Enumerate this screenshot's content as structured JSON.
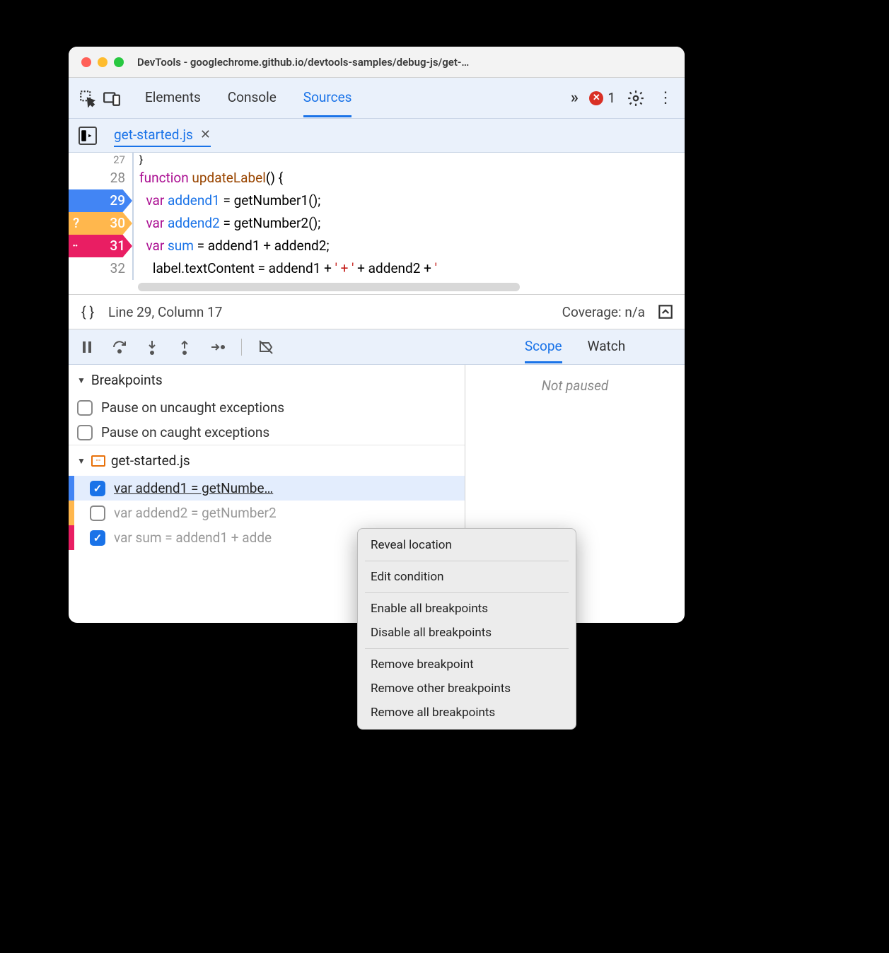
{
  "window": {
    "title": "DevTools - googlechrome.github.io/devtools-samples/debug-js/get-…"
  },
  "topTabs": {
    "elements": "Elements",
    "console": "Console",
    "sources": "Sources",
    "error_count": "1"
  },
  "fileTab": {
    "name": "get-started.js"
  },
  "code": {
    "l27": "  }",
    "l28_func": "function",
    "l28_name": " updateLabel",
    "l28_rest": "() {",
    "l29_var": "var",
    "l29_name": " addend1",
    "l29_rest": " = getNumber1();",
    "l30_var": "var",
    "l30_name": " addend2",
    "l30_rest": " = getNumber2();",
    "l31_var": "var",
    "l31_name": " sum",
    "l31_rest": " = addend1 + addend2;",
    "l32_a": "    label.textContent = addend1 + ",
    "l32_str": "' + '",
    "l32_b": " + addend2 + ",
    "l32_str2": "'",
    "nums": {
      "n27": "27",
      "n28": "28",
      "n29": "29",
      "n30": "30",
      "n31": "31",
      "n32": "32"
    },
    "bp30_badge": "?",
    "bp31_badge": "··"
  },
  "status": {
    "pos": "Line 29, Column 17",
    "coverage": "Coverage: n/a"
  },
  "rightTabs": {
    "scope": "Scope",
    "watch": "Watch",
    "not_paused": "Not paused"
  },
  "bp": {
    "header": "Breakpoints",
    "uncaught": "Pause on uncaught exceptions",
    "caught": "Pause on caught exceptions",
    "file": "get-started.js",
    "row1": "var addend1 = getNumbe…",
    "row2": "var addend2 = getNumber2",
    "row3": "var sum = addend1 + adde"
  },
  "ctx": {
    "reveal": "Reveal location",
    "edit": "Edit condition",
    "enable_all": "Enable all breakpoints",
    "disable_all": "Disable all breakpoints",
    "remove": "Remove breakpoint",
    "remove_other": "Remove other breakpoints",
    "remove_all": "Remove all breakpoints"
  }
}
